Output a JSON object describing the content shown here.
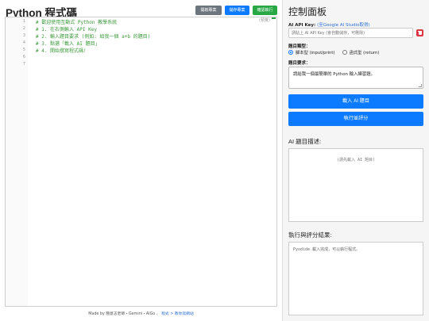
{
  "page": {
    "title": "Python 程式碼"
  },
  "toolbar": {
    "open_label": "開啟專案",
    "save_label": "儲存專案",
    "run_label": "確認執行"
  },
  "editor": {
    "tag": "(預覽)",
    "line_numbers": [
      "1",
      "2",
      "3",
      "4",
      "5",
      "6",
      "7"
    ],
    "lines": [
      "# 歡迎使用互動式 Python 教學系統",
      "# 1. 在右側輸入 API Key",
      "# 2. 輸入題目要求 (例如: 給我一個 a+b 的題目)",
      "# 3. 點選「載入 AI 題目」",
      "# 4. 開始撰寫程式碼!",
      "",
      ""
    ]
  },
  "footer": {
    "prefix": "Made by 簡意志老師・Gemini・AIGo 、",
    "link": "程式 > 教你寫網站"
  },
  "control": {
    "title": "控制面板",
    "api_label": "AI API Key:",
    "api_link": "(至Google AI Studio取得)",
    "api_placeholder": "請貼上 AI API Key (會自動儲存，可刪除)",
    "type_label": "題目類型：",
    "type_options": [
      "腳本型 (input/print)",
      "函式型 (return)"
    ],
    "type_selected": "腳本型 (input/print)",
    "req_label": "題目要求：",
    "req_value": "請給我一個最簡單的 Python 輸入練習題。",
    "load_button": "載入 AI 題目",
    "eval_button": "執行並評分"
  },
  "description": {
    "heading": "AI 題目描述:",
    "placeholder": "(請先載入 AI 題目)"
  },
  "result": {
    "heading": "執行與評分結果:",
    "text": "Pyodide 載入完成，可以執行程式。"
  },
  "colors": {
    "primary": "#0d7bff",
    "success": "#28a745",
    "secondary": "#6c757d",
    "danger": "#dc3545",
    "comment": "#3a9a3a"
  }
}
